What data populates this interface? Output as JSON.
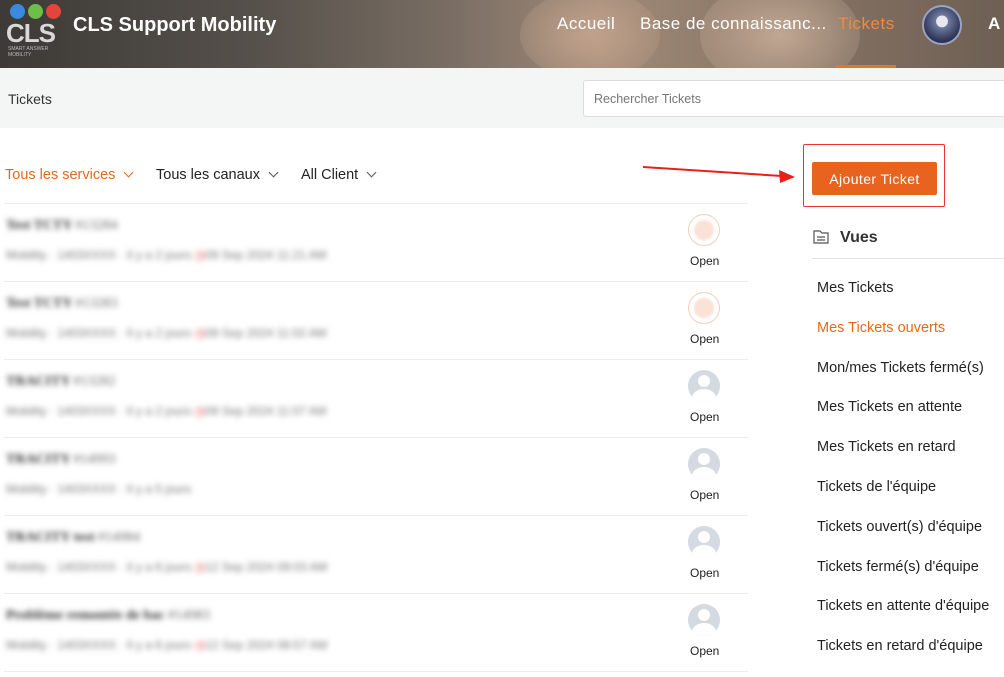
{
  "header": {
    "logo_text": "CLS",
    "logo_subtext": "SMART ANSWER MOBILITY",
    "brand": "CLS Support Mobility",
    "nav": [
      {
        "label": "Accueil"
      },
      {
        "label": "Base de connaissanc..."
      },
      {
        "label": "Tickets",
        "active": true
      }
    ],
    "more_label": "A"
  },
  "subbar": {
    "title": "Tickets",
    "search_placeholder": "Rechercher Tickets"
  },
  "filters": {
    "services": "Tous les services",
    "canaux": "Tous les canaux",
    "client": "All Client"
  },
  "tickets": [
    {
      "title": "Test TCTY",
      "id": "#13284",
      "meta": "Mobility · 1403XXXX · Il y a 2 jours",
      "due": "09 Sep 2024 11:21 AM",
      "status": "Open",
      "avatar": "orange"
    },
    {
      "title": "Test TCTY",
      "id": "#13283",
      "meta": "Mobility · 1403XXXX · Il y a 2 jours",
      "due": "09 Sep 2024 11:02 AM",
      "status": "Open",
      "avatar": "orange"
    },
    {
      "title": "TRACITY",
      "id": "#13282",
      "meta": "Mobility · 1403XXXX · Il y a 2 jours",
      "due": "09 Sep 2024 11:07 AM",
      "status": "Open",
      "avatar": "grey"
    },
    {
      "title": "TRACITY",
      "id": "#14993",
      "meta": "Mobility · 1403XXXX · Il y a 5 jours",
      "due": "",
      "status": "Open",
      "avatar": "grey"
    },
    {
      "title": "TRACITY test",
      "id": "#14984",
      "meta": "Mobility · 1403XXXX · Il y a 6 jours",
      "due": "12 Sep 2024 09:03 AM",
      "status": "Open",
      "avatar": "grey"
    },
    {
      "title": "Problème remontée de bac",
      "id": "#14983",
      "meta": "Mobility · 1403XXXX · Il y a 6 jours",
      "due": "12 Sep 2024 08:57 AM",
      "status": "Open",
      "avatar": "grey"
    }
  ],
  "add_ticket_label": "Ajouter Ticket",
  "views": {
    "title": "Vues",
    "items": [
      {
        "label": "Mes Tickets"
      },
      {
        "label": "Mes Tickets ouverts",
        "active": true
      },
      {
        "label": "Mon/mes Tickets fermé(s)"
      },
      {
        "label": "Mes Tickets en attente"
      },
      {
        "label": "Mes Tickets en retard"
      },
      {
        "label": "Tickets de l'équipe"
      },
      {
        "label": "Tickets ouvert(s) d'équipe"
      },
      {
        "label": "Tickets fermé(s) d'équipe"
      },
      {
        "label": "Tickets en attente d'équipe"
      },
      {
        "label": "Tickets en retard d'équipe"
      }
    ]
  },
  "colors": {
    "accent": "#e8641e",
    "highlight_box": "#e33333"
  }
}
